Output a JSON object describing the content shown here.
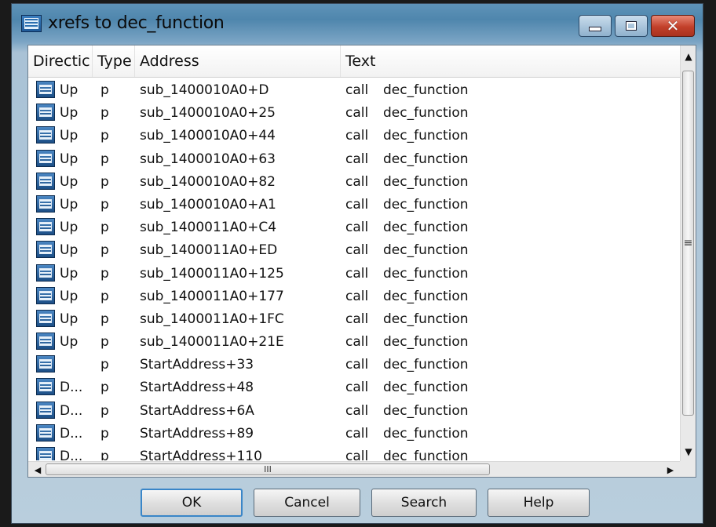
{
  "window": {
    "title": "xrefs to dec_function"
  },
  "columns": {
    "direction": "Directic",
    "type": "Type",
    "address": "Address",
    "text": "Text"
  },
  "rows": [
    {
      "dir": "Up",
      "type": "p",
      "addr": "sub_1400010A0+D",
      "ins": "call",
      "op": "dec_function"
    },
    {
      "dir": "Up",
      "type": "p",
      "addr": "sub_1400010A0+25",
      "ins": "call",
      "op": "dec_function"
    },
    {
      "dir": "Up",
      "type": "p",
      "addr": "sub_1400010A0+44",
      "ins": "call",
      "op": "dec_function"
    },
    {
      "dir": "Up",
      "type": "p",
      "addr": "sub_1400010A0+63",
      "ins": "call",
      "op": "dec_function"
    },
    {
      "dir": "Up",
      "type": "p",
      "addr": "sub_1400010A0+82",
      "ins": "call",
      "op": "dec_function"
    },
    {
      "dir": "Up",
      "type": "p",
      "addr": "sub_1400010A0+A1",
      "ins": "call",
      "op": "dec_function"
    },
    {
      "dir": "Up",
      "type": "p",
      "addr": "sub_1400011A0+C4",
      "ins": "call",
      "op": "dec_function"
    },
    {
      "dir": "Up",
      "type": "p",
      "addr": "sub_1400011A0+ED",
      "ins": "call",
      "op": "dec_function"
    },
    {
      "dir": "Up",
      "type": "p",
      "addr": "sub_1400011A0+125",
      "ins": "call",
      "op": "dec_function"
    },
    {
      "dir": "Up",
      "type": "p",
      "addr": "sub_1400011A0+177",
      "ins": "call",
      "op": "dec_function"
    },
    {
      "dir": "Up",
      "type": "p",
      "addr": "sub_1400011A0+1FC",
      "ins": "call",
      "op": "dec_function"
    },
    {
      "dir": "Up",
      "type": "p",
      "addr": "sub_1400011A0+21E",
      "ins": "call",
      "op": "dec_function"
    },
    {
      "dir": "",
      "type": "p",
      "addr": "StartAddress+33",
      "ins": "call",
      "op": "dec_function"
    },
    {
      "dir": "D...",
      "type": "p",
      "addr": "StartAddress+48",
      "ins": "call",
      "op": "dec_function"
    },
    {
      "dir": "D...",
      "type": "p",
      "addr": "StartAddress+6A",
      "ins": "call",
      "op": "dec_function"
    },
    {
      "dir": "D...",
      "type": "p",
      "addr": "StartAddress+89",
      "ins": "call",
      "op": "dec_function"
    },
    {
      "dir": "D...",
      "type": "p",
      "addr": "StartAddress+110",
      "ins": "call",
      "op": "dec_function"
    }
  ],
  "buttons": {
    "ok": "OK",
    "cancel": "Cancel",
    "search": "Search",
    "help": "Help"
  },
  "icons": {
    "title": "xref-list-icon",
    "row": "xref-list-icon",
    "minimize": "minimize-icon",
    "maximize": "maximize-icon",
    "close": "close-icon"
  },
  "colors": {
    "close_button": "#c2402a",
    "title_bar": "#5e93b8",
    "default_button_border": "#3a86c8"
  }
}
